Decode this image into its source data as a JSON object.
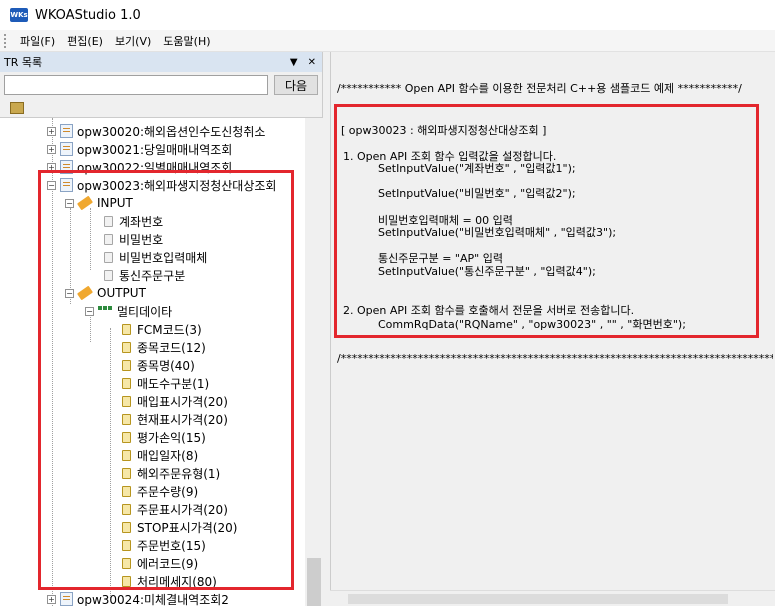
{
  "window": {
    "title": "WKOAStudio 1.0",
    "icon_text": "WKs"
  },
  "menu": {
    "items": [
      "파일(F)",
      "편집(E)",
      "보기(V)",
      "도움말(H)"
    ]
  },
  "left_panel": {
    "title": "TR 목록",
    "header_buttons": [
      "▼",
      "✕"
    ],
    "search": {
      "value": "",
      "placeholder": ""
    },
    "search_button": "다음"
  },
  "tree": {
    "items_top": [
      "opw30020:해외옵션인수도신청취소",
      "opw30021:당일매매내역조회",
      "opw30022:일별매매내역조회"
    ],
    "selected": "opw30023:해외파생지정청산대상조회",
    "input_label": "INPUT",
    "input_fields": [
      "계좌번호",
      "비밀번호",
      "비밀번호입력매체",
      "통신주문구분"
    ],
    "output_label": "OUTPUT",
    "multi_label": "멀티데이타",
    "output_fields": [
      "FCM코드(3)",
      "종목코드(12)",
      "종목명(40)",
      "매도수구분(1)",
      "매입표시가격(20)",
      "현재표시가격(20)",
      "평가손익(15)",
      "매입일자(8)",
      "해외주문유형(1)",
      "주문수량(9)",
      "주문표시가격(20)",
      "STOP표시가격(20)",
      "주문번호(15)",
      "에러코드(9)",
      "처리메세지(80)"
    ],
    "items_bottom": [
      "opw30024:미체결내역조회2"
    ]
  },
  "code": {
    "header": "/*********** Open API 함수를 이용한 전문처리 C++용 샘플코드 예제 ***********/",
    "title": "[ opw30023 : 해외파생지정청산대상조회 ]",
    "step1": "1. Open API 조회 함수 입력값을 설정합니다.",
    "line1": "SetInputValue(\"계좌번호\"                  ,     \"입력값1\");",
    "line2": "SetInputValue(\"비밀번호\"                  ,     \"입력값2\");",
    "comment3": "비밀번호입력매체 = 00 입력",
    "line3": "SetInputValue(\"비밀번호입력매체\"       ,     \"입력값3\");",
    "comment4": "통신주문구분 = \"AP\" 입력",
    "line4": "SetInputValue(\"통신주문구분\"          ,     \"입력값4\");",
    "step2": "2. Open API 조회 함수를 호출해서 전문을 서버로 전송합니다.",
    "call": "CommRqData(\"RQName\"  ,  \"opw30023\"  ,  \"\"  ,  \"화면번호\");",
    "footer": "/****************************************************************************************************"
  }
}
